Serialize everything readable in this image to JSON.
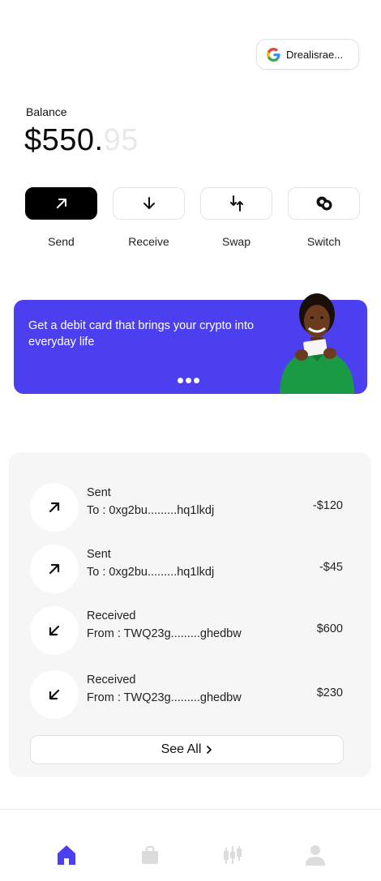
{
  "account": {
    "name": "Drealisrae...",
    "provider_icon": "google-icon"
  },
  "balance": {
    "label": "Balance",
    "whole": "$550.",
    "cents": "95"
  },
  "actions": [
    {
      "label": "Send",
      "icon": "arrow-up-right-icon",
      "active": true
    },
    {
      "label": "Receive",
      "icon": "arrow-down-icon",
      "active": false
    },
    {
      "label": "Swap",
      "icon": "swap-icon",
      "active": false
    },
    {
      "label": "Switch",
      "icon": "switch-icon",
      "active": false
    }
  ],
  "promo": {
    "text": "Get a debit card that brings your crypto into everyday life",
    "accent": "#4b3ff0",
    "slide_count": 3
  },
  "transactions": [
    {
      "type": "Sent",
      "address": "To : 0xg2bu.........hq1lkdj",
      "amount": "-$120",
      "direction": "out"
    },
    {
      "type": "Sent",
      "address": "To : 0xg2bu.........hq1lkdj",
      "amount": "-$45",
      "direction": "out"
    },
    {
      "type": "Received",
      "address": "From : TWQ23g.........ghedbw",
      "amount": "$600",
      "direction": "in"
    },
    {
      "type": "Received",
      "address": "From : TWQ23g.........ghedbw",
      "amount": "$230",
      "direction": "in"
    }
  ],
  "see_all": {
    "label": "See All",
    "icon": "chevron-right-icon"
  },
  "bottom_nav": [
    {
      "name": "home",
      "icon": "home-icon",
      "active": true,
      "active_color": "#4b3ff0"
    },
    {
      "name": "wallet",
      "icon": "briefcase-icon",
      "active": false
    },
    {
      "name": "markets",
      "icon": "candlestick-icon",
      "active": false
    },
    {
      "name": "profile",
      "icon": "user-icon",
      "active": false
    }
  ]
}
